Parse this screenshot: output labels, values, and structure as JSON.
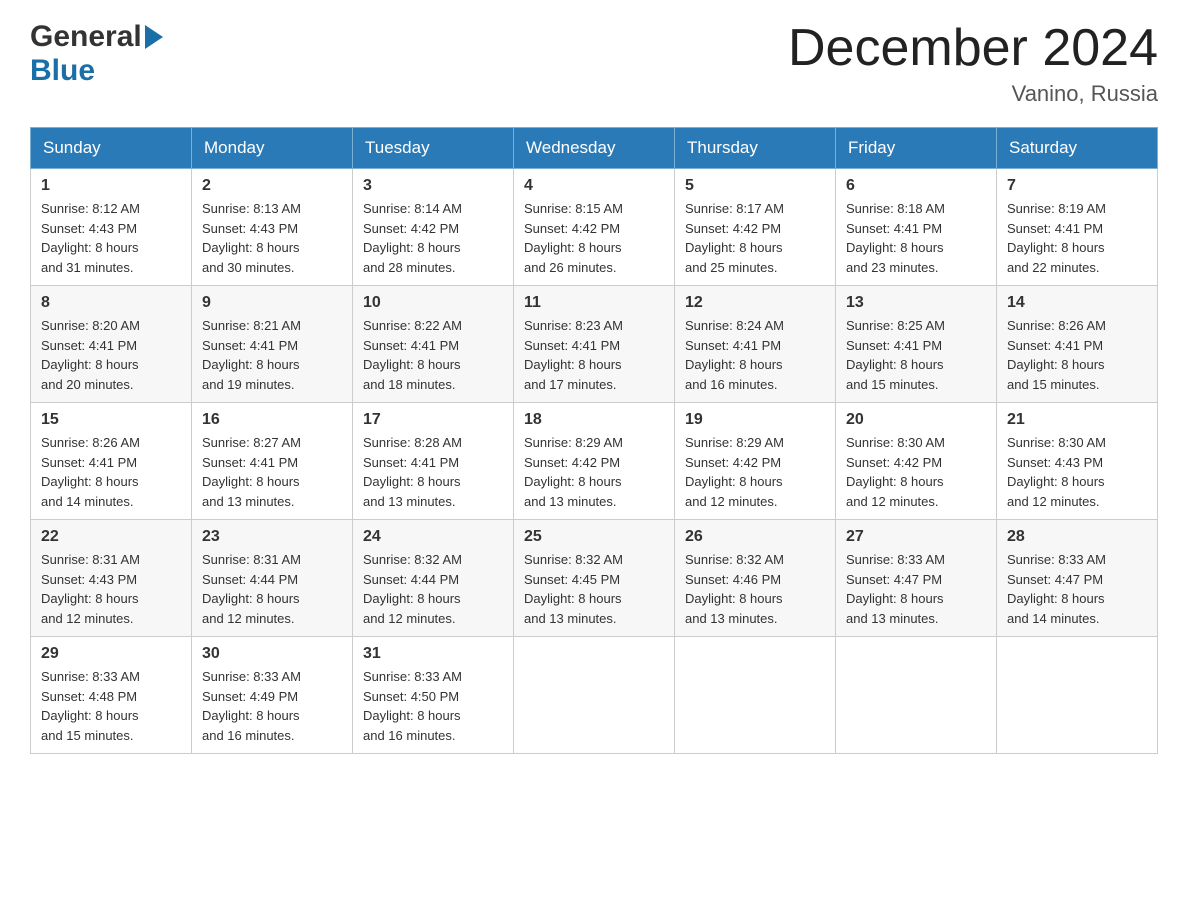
{
  "header": {
    "logo_general": "General",
    "logo_blue": "Blue",
    "title": "December 2024",
    "location": "Vanino, Russia"
  },
  "weekdays": [
    "Sunday",
    "Monday",
    "Tuesday",
    "Wednesday",
    "Thursday",
    "Friday",
    "Saturday"
  ],
  "weeks": [
    [
      {
        "day": "1",
        "sunrise": "8:12 AM",
        "sunset": "4:43 PM",
        "daylight": "8 hours and 31 minutes."
      },
      {
        "day": "2",
        "sunrise": "8:13 AM",
        "sunset": "4:43 PM",
        "daylight": "8 hours and 30 minutes."
      },
      {
        "day": "3",
        "sunrise": "8:14 AM",
        "sunset": "4:42 PM",
        "daylight": "8 hours and 28 minutes."
      },
      {
        "day": "4",
        "sunrise": "8:15 AM",
        "sunset": "4:42 PM",
        "daylight": "8 hours and 26 minutes."
      },
      {
        "day": "5",
        "sunrise": "8:17 AM",
        "sunset": "4:42 PM",
        "daylight": "8 hours and 25 minutes."
      },
      {
        "day": "6",
        "sunrise": "8:18 AM",
        "sunset": "4:41 PM",
        "daylight": "8 hours and 23 minutes."
      },
      {
        "day": "7",
        "sunrise": "8:19 AM",
        "sunset": "4:41 PM",
        "daylight": "8 hours and 22 minutes."
      }
    ],
    [
      {
        "day": "8",
        "sunrise": "8:20 AM",
        "sunset": "4:41 PM",
        "daylight": "8 hours and 20 minutes."
      },
      {
        "day": "9",
        "sunrise": "8:21 AM",
        "sunset": "4:41 PM",
        "daylight": "8 hours and 19 minutes."
      },
      {
        "day": "10",
        "sunrise": "8:22 AM",
        "sunset": "4:41 PM",
        "daylight": "8 hours and 18 minutes."
      },
      {
        "day": "11",
        "sunrise": "8:23 AM",
        "sunset": "4:41 PM",
        "daylight": "8 hours and 17 minutes."
      },
      {
        "day": "12",
        "sunrise": "8:24 AM",
        "sunset": "4:41 PM",
        "daylight": "8 hours and 16 minutes."
      },
      {
        "day": "13",
        "sunrise": "8:25 AM",
        "sunset": "4:41 PM",
        "daylight": "8 hours and 15 minutes."
      },
      {
        "day": "14",
        "sunrise": "8:26 AM",
        "sunset": "4:41 PM",
        "daylight": "8 hours and 15 minutes."
      }
    ],
    [
      {
        "day": "15",
        "sunrise": "8:26 AM",
        "sunset": "4:41 PM",
        "daylight": "8 hours and 14 minutes."
      },
      {
        "day": "16",
        "sunrise": "8:27 AM",
        "sunset": "4:41 PM",
        "daylight": "8 hours and 13 minutes."
      },
      {
        "day": "17",
        "sunrise": "8:28 AM",
        "sunset": "4:41 PM",
        "daylight": "8 hours and 13 minutes."
      },
      {
        "day": "18",
        "sunrise": "8:29 AM",
        "sunset": "4:42 PM",
        "daylight": "8 hours and 13 minutes."
      },
      {
        "day": "19",
        "sunrise": "8:29 AM",
        "sunset": "4:42 PM",
        "daylight": "8 hours and 12 minutes."
      },
      {
        "day": "20",
        "sunrise": "8:30 AM",
        "sunset": "4:42 PM",
        "daylight": "8 hours and 12 minutes."
      },
      {
        "day": "21",
        "sunrise": "8:30 AM",
        "sunset": "4:43 PM",
        "daylight": "8 hours and 12 minutes."
      }
    ],
    [
      {
        "day": "22",
        "sunrise": "8:31 AM",
        "sunset": "4:43 PM",
        "daylight": "8 hours and 12 minutes."
      },
      {
        "day": "23",
        "sunrise": "8:31 AM",
        "sunset": "4:44 PM",
        "daylight": "8 hours and 12 minutes."
      },
      {
        "day": "24",
        "sunrise": "8:32 AM",
        "sunset": "4:44 PM",
        "daylight": "8 hours and 12 minutes."
      },
      {
        "day": "25",
        "sunrise": "8:32 AM",
        "sunset": "4:45 PM",
        "daylight": "8 hours and 13 minutes."
      },
      {
        "day": "26",
        "sunrise": "8:32 AM",
        "sunset": "4:46 PM",
        "daylight": "8 hours and 13 minutes."
      },
      {
        "day": "27",
        "sunrise": "8:33 AM",
        "sunset": "4:47 PM",
        "daylight": "8 hours and 13 minutes."
      },
      {
        "day": "28",
        "sunrise": "8:33 AM",
        "sunset": "4:47 PM",
        "daylight": "8 hours and 14 minutes."
      }
    ],
    [
      {
        "day": "29",
        "sunrise": "8:33 AM",
        "sunset": "4:48 PM",
        "daylight": "8 hours and 15 minutes."
      },
      {
        "day": "30",
        "sunrise": "8:33 AM",
        "sunset": "4:49 PM",
        "daylight": "8 hours and 16 minutes."
      },
      {
        "day": "31",
        "sunrise": "8:33 AM",
        "sunset": "4:50 PM",
        "daylight": "8 hours and 16 minutes."
      },
      null,
      null,
      null,
      null
    ]
  ],
  "labels": {
    "sunrise": "Sunrise:",
    "sunset": "Sunset:",
    "daylight": "Daylight:"
  }
}
